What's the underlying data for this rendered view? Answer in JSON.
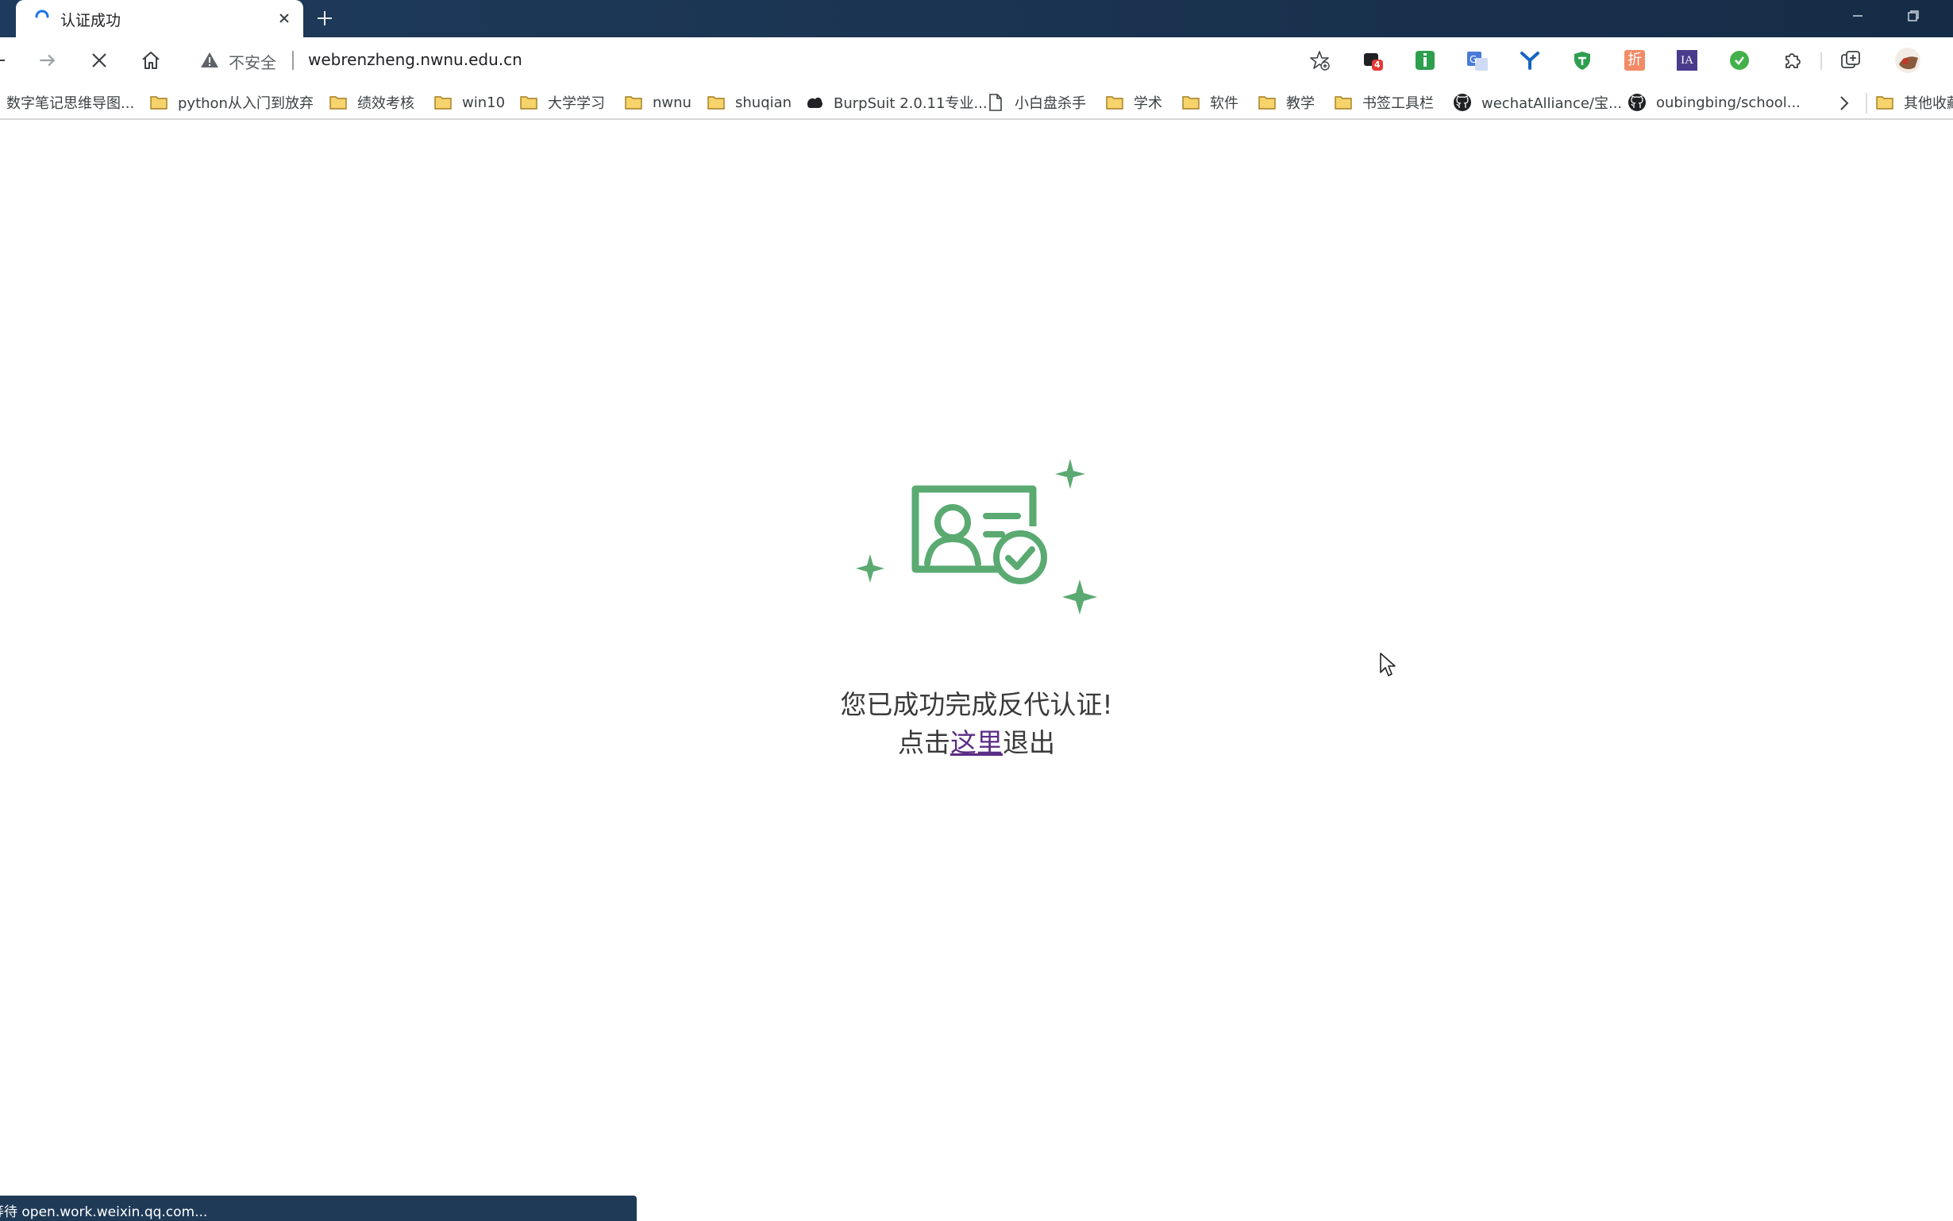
{
  "tab": {
    "title": "认证成功"
  },
  "omnibox": {
    "security_label": "不安全",
    "url": "webrenzheng.nwnu.edu.cn"
  },
  "bookmarks": [
    {
      "label": "数字笔记思维导图...",
      "icon": "none"
    },
    {
      "label": "python从入门到放弃",
      "icon": "folder-icon"
    },
    {
      "label": "绩效考核",
      "icon": "folder-icon"
    },
    {
      "label": "win10",
      "icon": "folder-icon"
    },
    {
      "label": "大学学习",
      "icon": "folder-icon"
    },
    {
      "label": "nwnu",
      "icon": "folder-icon"
    },
    {
      "label": "shuqian",
      "icon": "folder-icon"
    },
    {
      "label": "BurpSuit 2.0.11专业...",
      "icon": "burpsuite-icon"
    },
    {
      "label": "小白盘杀手",
      "icon": "page-icon"
    },
    {
      "label": "学术",
      "icon": "folder-icon"
    },
    {
      "label": "软件",
      "icon": "folder-icon"
    },
    {
      "label": "教学",
      "icon": "folder-icon"
    },
    {
      "label": "书签工具栏",
      "icon": "folder-icon"
    },
    {
      "label": "wechatAlliance/宝...",
      "icon": "github-icon"
    },
    {
      "label": "oubingbing/school...",
      "icon": "github-icon"
    },
    {
      "label": "其他收藏",
      "icon": "folder-icon"
    }
  ],
  "extensions": {
    "badge_count": "4",
    "zhe_label": "折",
    "ia_label": "IA"
  },
  "content": {
    "message": "您已成功完成反代认证!",
    "exit_prefix": "点击",
    "exit_link": "这里",
    "exit_suffix": "退出"
  },
  "status": {
    "text": "等待 open.work.weixin.qq.com..."
  },
  "colors": {
    "accent_green": "#5aaa72",
    "link_purple": "#5b2d86",
    "titlebar": "#1e3a5c"
  }
}
